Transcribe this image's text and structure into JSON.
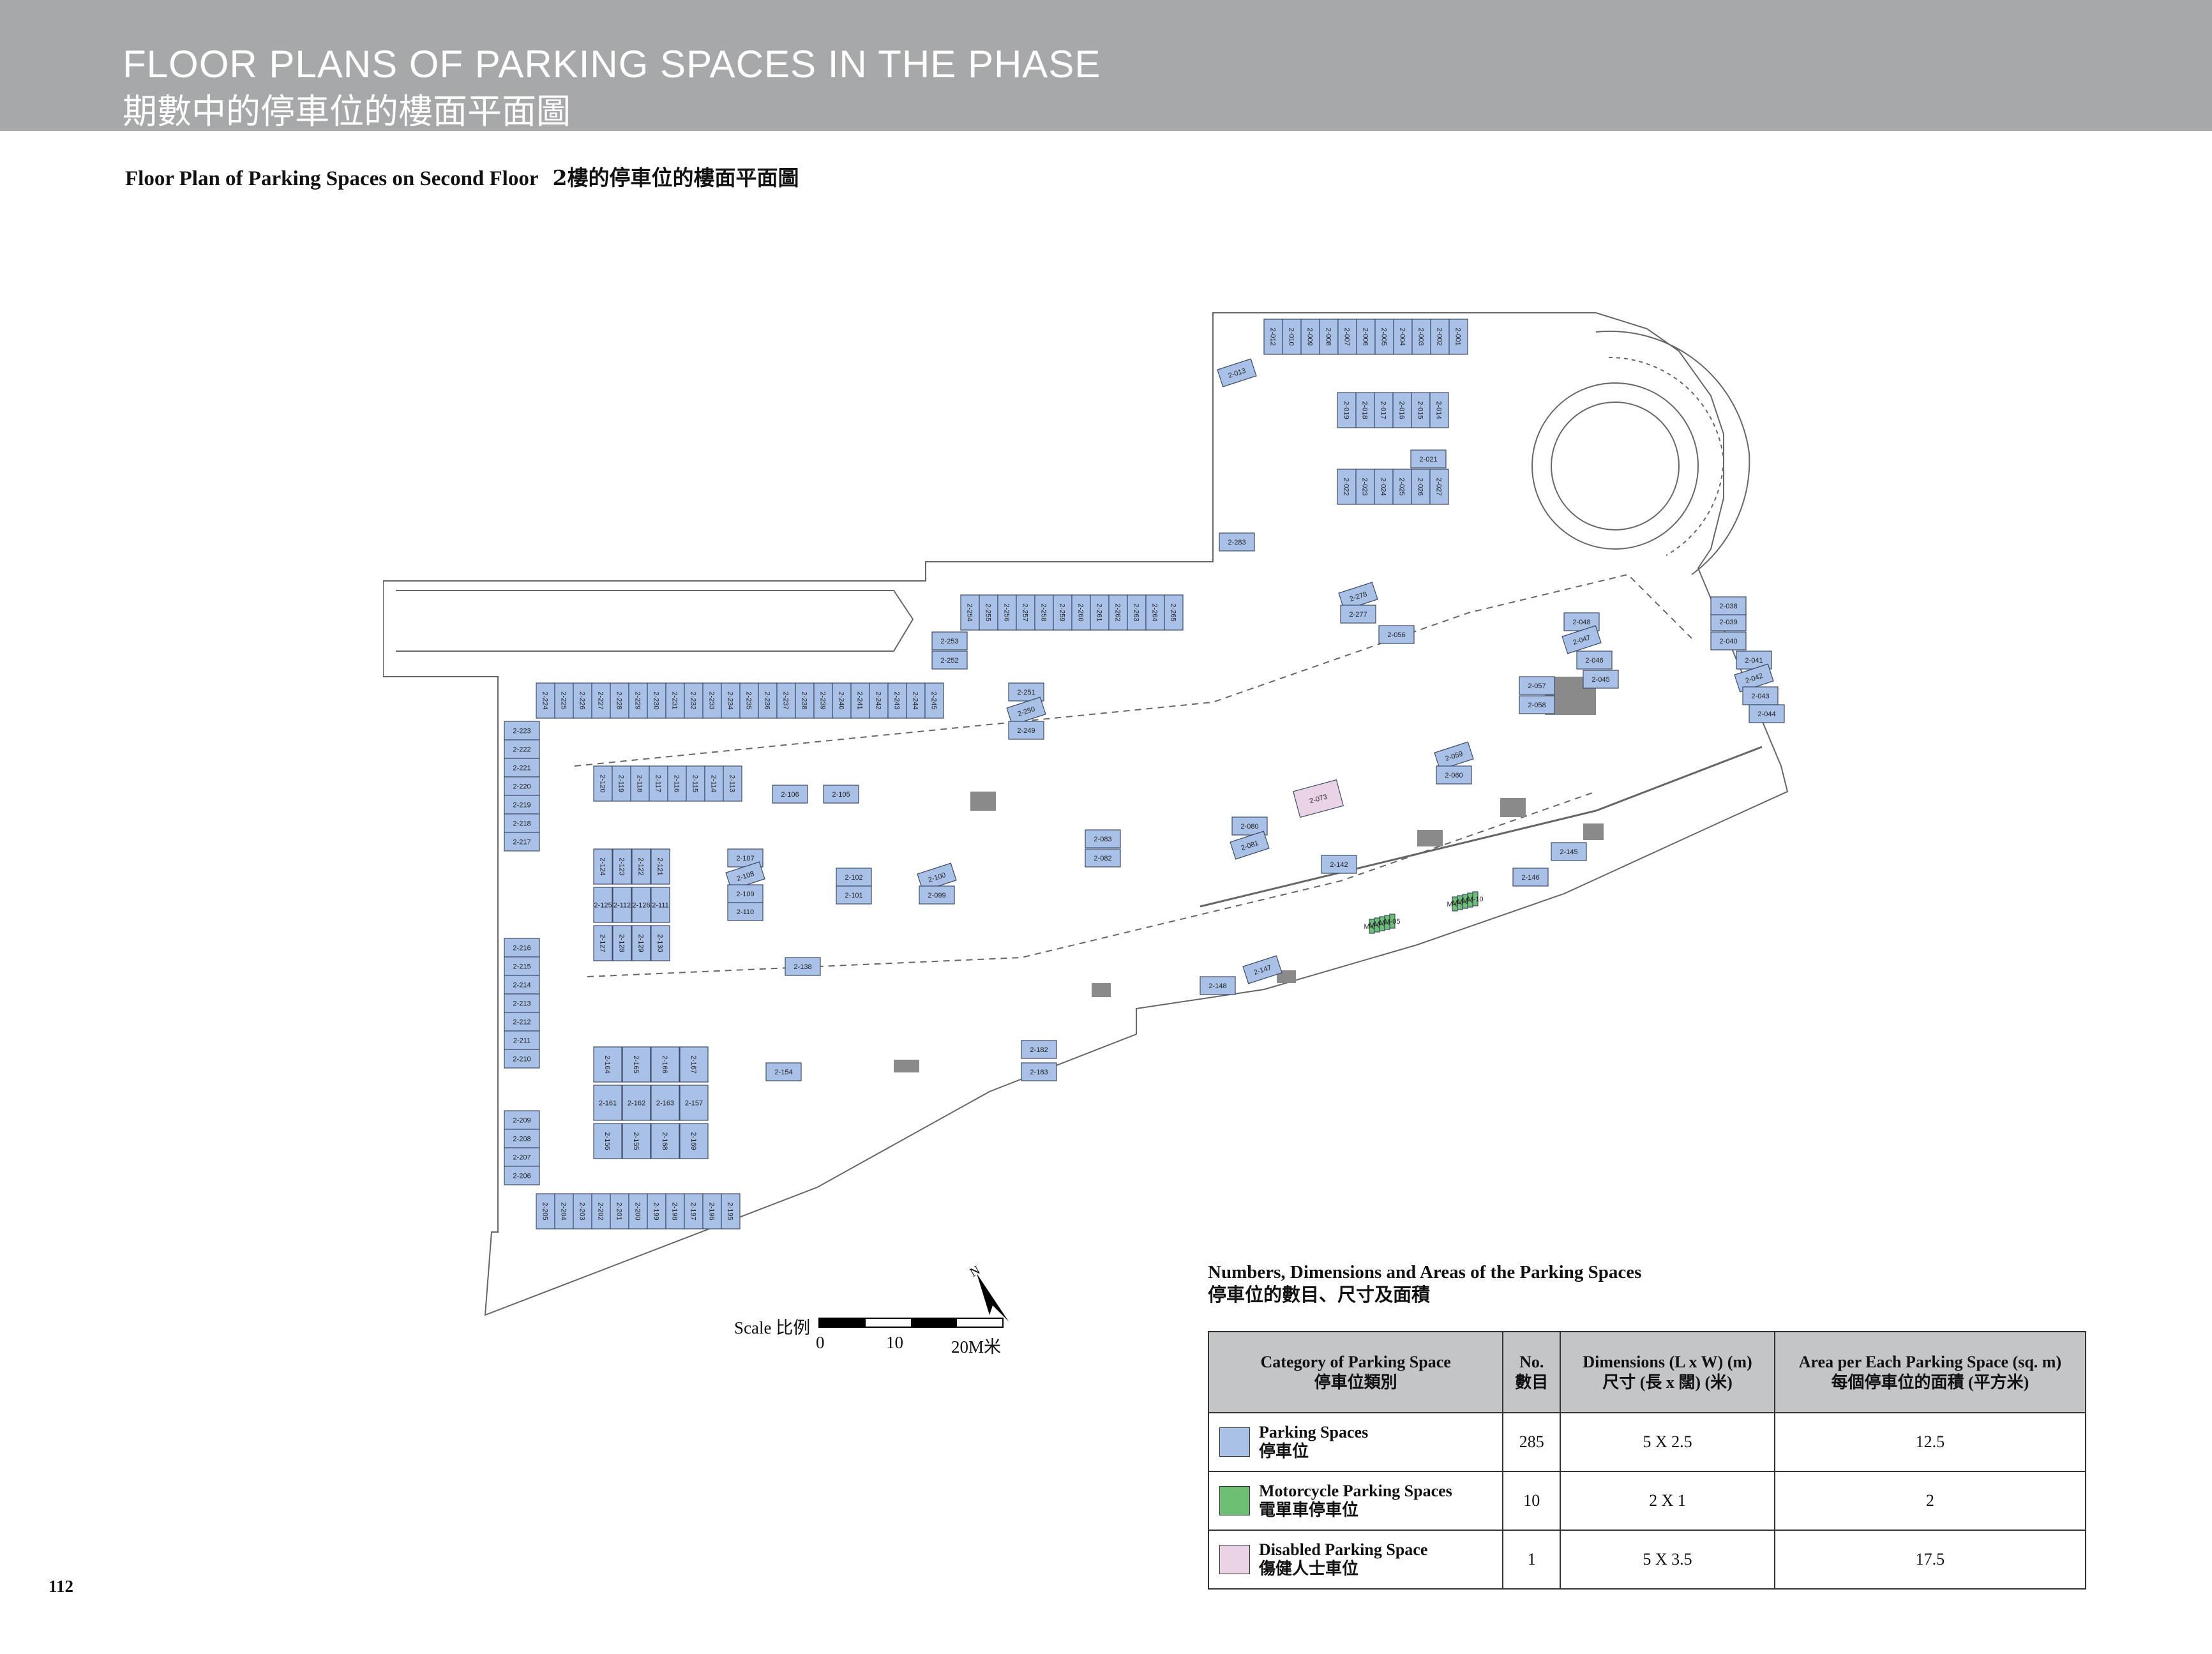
{
  "header": {
    "title_en": "FLOOR PLANS OF PARKING SPACES IN THE PHASE",
    "title_zh": "期數中的停車位的樓面平面圖"
  },
  "subtitle": {
    "en": "Floor Plan of Parking Spaces on Second Floor",
    "zh": "2樓的停車位的樓面平面圖"
  },
  "scale": {
    "label": "Scale 比例",
    "ticks": [
      "0",
      "10",
      "20M米"
    ]
  },
  "north": "N",
  "table": {
    "title_en": "Numbers, Dimensions and Areas of the Parking Spaces",
    "title_zh": "停車位的數目、尺寸及面積",
    "headers": [
      {
        "en": "Category of Parking Space",
        "zh": "停車位類別"
      },
      {
        "en": "No.",
        "zh": "數目"
      },
      {
        "en": "Dimensions (L x W) (m)",
        "zh": "尺寸 (長 x 闊) (米)"
      },
      {
        "en": "Area per Each Parking Space (sq. m)",
        "zh": "每個停車位的面積 (平方米)"
      }
    ],
    "rows": [
      {
        "en": "Parking Spaces",
        "zh": "停車位",
        "no": "285",
        "dim": "5 X 2.5",
        "area": "12.5",
        "color": "#a9c1e6"
      },
      {
        "en": "Motorcycle Parking Spaces",
        "zh": "電單車停車位",
        "no": "10",
        "dim": "2 X 1",
        "area": "2",
        "color": "#6dbf73"
      },
      {
        "en": "Disabled Parking Space",
        "zh": "傷健人士車位",
        "no": "1",
        "dim": "5 X 3.5",
        "area": "17.5",
        "color": "#ebd3e6"
      }
    ]
  },
  "page_number": "112",
  "plan": {
    "colors": {
      "parking": "#a9c1e6",
      "motorcycle": "#6dbf73",
      "disabled": "#ebd3e6",
      "line": "#666666",
      "core": "#8a8a8a"
    },
    "top_row": [
      "2-012",
      "2-010",
      "2-009",
      "2-008",
      "2-007",
      "2-006",
      "2-005",
      "2-004",
      "2-003",
      "2-002",
      "2-001"
    ],
    "left_column": [
      "2-223",
      "2-222",
      "2-221",
      "2-220",
      "2-219",
      "2-218",
      "2-217",
      "2-216",
      "2-215",
      "2-214",
      "2-213",
      "2-212",
      "2-211",
      "2-210",
      "2-209",
      "2-208",
      "2-207",
      "2-206"
    ],
    "long_row": [
      "2-224",
      "2-225",
      "2-226",
      "2-227",
      "2-228",
      "2-229",
      "2-230",
      "2-231",
      "2-232",
      "2-233",
      "2-234",
      "2-235",
      "2-236",
      "2-237",
      "2-238",
      "2-239",
      "2-240",
      "2-241",
      "2-242",
      "2-243",
      "2-244",
      "2-245"
    ],
    "upper_row": [
      "2-254",
      "2-255",
      "2-256",
      "2-257",
      "2-258",
      "2-259",
      "2-260",
      "2-261",
      "2-262",
      "2-263",
      "2-264",
      "2-265"
    ],
    "mid_row": [
      "2-120",
      "2-119",
      "2-118",
      "2-117",
      "2-116",
      "2-115",
      "2-114",
      "2-113"
    ],
    "bottom_row": [
      "2-205",
      "2-204",
      "2-203",
      "2-202",
      "2-201",
      "2-200",
      "2-199",
      "2-198",
      "2-197",
      "2-196",
      "2-195"
    ],
    "block_a": [
      "2-124",
      "2-123",
      "2-122",
      "2-121",
      "2-125",
      "2-112",
      "2-126",
      "2-111",
      "2-127",
      "2-128",
      "2-129",
      "2-130"
    ],
    "block_b": [
      "2-164",
      "2-165",
      "2-166",
      "2-167",
      "2-161",
      "2-162",
      "2-163",
      "2-157",
      "2-156",
      "2-155",
      "2-168",
      "2-169"
    ],
    "core_block": [
      "2-019",
      "2-018",
      "2-017",
      "2-016",
      "2-015",
      "2-014",
      "2-022",
      "2-023",
      "2-024",
      "2-025",
      "2-026",
      "2-027"
    ],
    "misc_horizontal": [
      "2-013",
      "2-283",
      "2-253",
      "2-252",
      "2-251",
      "2-250",
      "2-249",
      "2-106",
      "2-105",
      "2-107",
      "2-108",
      "2-109",
      "2-110",
      "2-102",
      "2-101",
      "2-100",
      "2-099",
      "2-083",
      "2-082",
      "2-080",
      "2-081",
      "2-138",
      "2-154",
      "2-182",
      "2-183",
      "2-147",
      "2-148",
      "2-146",
      "2-145",
      "2-142",
      "2-278",
      "2-277",
      "2-056",
      "2-021",
      "2-048",
      "2-047",
      "2-046",
      "2-045",
      "2-057",
      "2-058",
      "2-059",
      "2-060",
      "2-039",
      "2-040",
      "2-041",
      "2-042",
      "2-043",
      "2-044",
      "2-038"
    ],
    "motorcycle": [
      "M-01",
      "M-02",
      "M-03",
      "M-04",
      "M-05",
      "M-06",
      "M-07",
      "M-08",
      "M-09",
      "M-10"
    ],
    "disabled": [
      "2-073"
    ]
  }
}
